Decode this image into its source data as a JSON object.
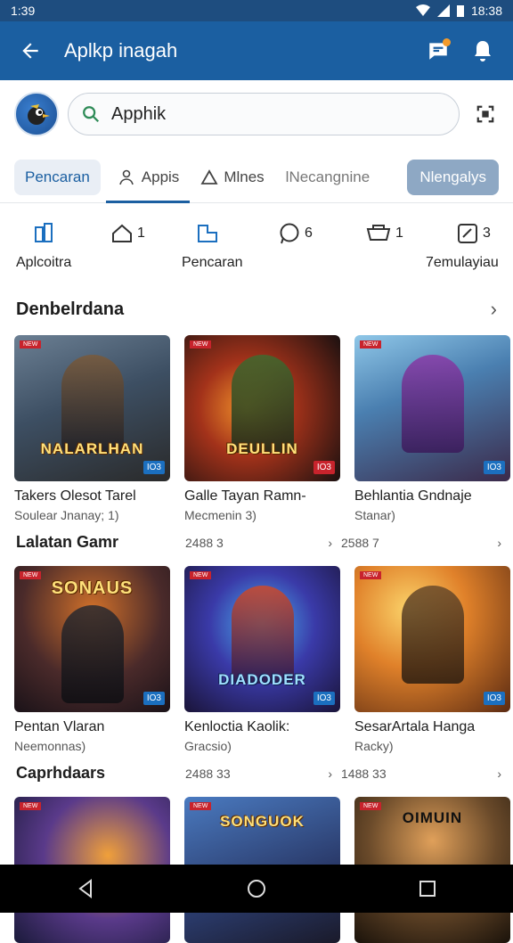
{
  "status": {
    "time": "1:39",
    "right_time": "18:38"
  },
  "appbar": {
    "title": "Aplkp inagah"
  },
  "search": {
    "value": "Apphik"
  },
  "tabs": [
    {
      "label": "Pencaran"
    },
    {
      "label": "Appis"
    },
    {
      "label": "Mlnes"
    },
    {
      "label": "lNecangnine"
    },
    {
      "label": "Nlengalys"
    }
  ],
  "shortcuts": [
    {
      "count": "",
      "label": "Aplcoitra"
    },
    {
      "count": "1",
      "label": ""
    },
    {
      "count": "",
      "label": "Pencaran"
    },
    {
      "count": "6",
      "label": ""
    },
    {
      "count": "1",
      "label": ""
    },
    {
      "count": "3",
      "label": "7emulayiau"
    }
  ],
  "sections": [
    {
      "title": "Denbelrdana"
    },
    {
      "title": "Lalatan Gamr"
    },
    {
      "title": "Caprhdaars"
    }
  ],
  "row1": [
    {
      "name": "Takers Olesot Tarel",
      "sub": "Soulear Jnanay; 1)",
      "art": "NALARLHAN",
      "badge": "IO3"
    },
    {
      "name": "Galle Tayan Ramn-",
      "sub": "Mecmenin 3)",
      "art": "DEULLIN",
      "badge": "IO3"
    },
    {
      "name": "Behlantia Gndnaje",
      "sub": "Stanar)",
      "art": "",
      "badge": "IO3"
    }
  ],
  "row1_meta": [
    "2488 3",
    "2588 7"
  ],
  "row2": [
    {
      "name": "Pentan Vlaran",
      "sub": "Neemonnas)",
      "art": "SONAUS",
      "badge": "IO3"
    },
    {
      "name": "Kenloctia Kaolik:",
      "sub": "Gracsio)",
      "art": "DIADODER",
      "badge": "IO3"
    },
    {
      "name": "SesarArtala Hanga",
      "sub": "Racky)",
      "art": "",
      "badge": "IO3"
    }
  ],
  "row2_meta": [
    "2488 33",
    "1488 33"
  ],
  "row3": [
    {
      "art": ""
    },
    {
      "art": "SONGUOK"
    },
    {
      "art": "OIMUIN"
    }
  ],
  "colors": {
    "appbar": "#1b5fa1",
    "status": "#1e4d7f",
    "accent": "#1b5fa1"
  }
}
